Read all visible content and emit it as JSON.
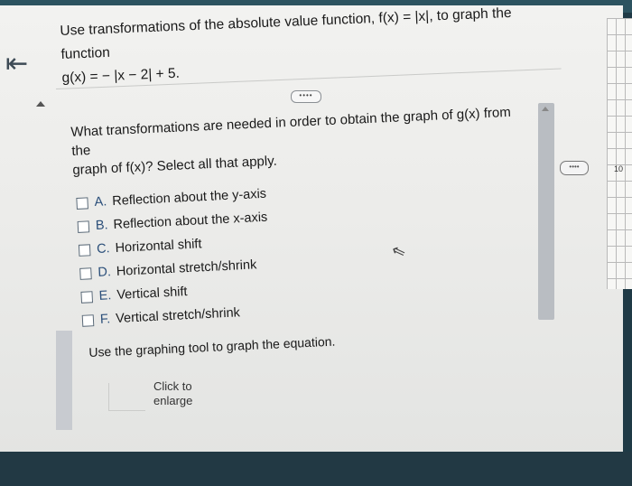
{
  "problem": {
    "line1": "Use transformations of the absolute value function, f(x) = |x|, to graph the function",
    "line2": "g(x) = − |x − 2| + 5."
  },
  "question": {
    "line1": "What transformations are needed in order to obtain the graph of g(x) from the",
    "line2": "graph of f(x)? Select all that apply."
  },
  "options": [
    {
      "letter": "A.",
      "label": "Reflection about the y-axis"
    },
    {
      "letter": "B.",
      "label": "Reflection about the x-axis"
    },
    {
      "letter": "C.",
      "label": "Horizontal shift"
    },
    {
      "letter": "D.",
      "label": "Horizontal stretch/shrink"
    },
    {
      "letter": "E.",
      "label": "Vertical shift"
    },
    {
      "letter": "F.",
      "label": "Vertical stretch/shrink"
    }
  ],
  "graph_instruction": "Use the graphing tool to graph the equation.",
  "click_to_enlarge": {
    "line1": "Click to",
    "line2": "enlarge"
  },
  "expand_button": "••••",
  "side_grid_label": "10",
  "icons": {
    "back": "back-arrow-icon",
    "cursor": "mouse-pointer-icon"
  }
}
